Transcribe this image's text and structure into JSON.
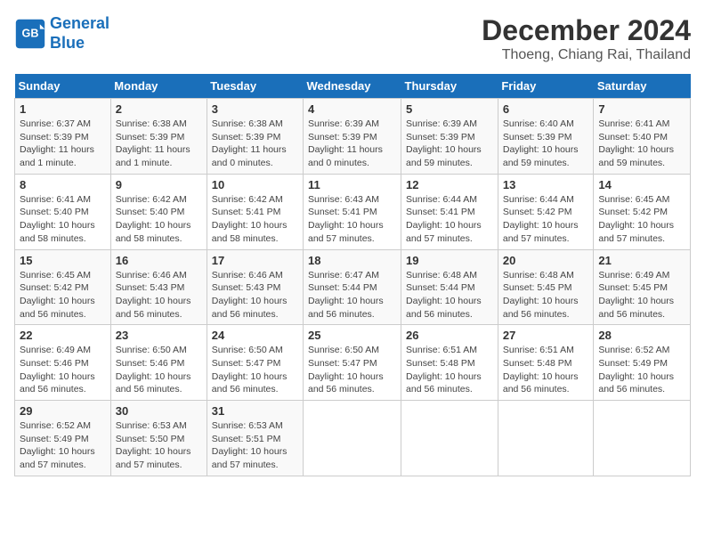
{
  "logo": {
    "line1": "General",
    "line2": "Blue"
  },
  "title": "December 2024",
  "location": "Thoeng, Chiang Rai, Thailand",
  "headers": [
    "Sunday",
    "Monday",
    "Tuesday",
    "Wednesday",
    "Thursday",
    "Friday",
    "Saturday"
  ],
  "weeks": [
    [
      {
        "day": "1",
        "info": "Sunrise: 6:37 AM\nSunset: 5:39 PM\nDaylight: 11 hours and 1 minute."
      },
      {
        "day": "2",
        "info": "Sunrise: 6:38 AM\nSunset: 5:39 PM\nDaylight: 11 hours and 1 minute."
      },
      {
        "day": "3",
        "info": "Sunrise: 6:38 AM\nSunset: 5:39 PM\nDaylight: 11 hours and 0 minutes."
      },
      {
        "day": "4",
        "info": "Sunrise: 6:39 AM\nSunset: 5:39 PM\nDaylight: 11 hours and 0 minutes."
      },
      {
        "day": "5",
        "info": "Sunrise: 6:39 AM\nSunset: 5:39 PM\nDaylight: 10 hours and 59 minutes."
      },
      {
        "day": "6",
        "info": "Sunrise: 6:40 AM\nSunset: 5:39 PM\nDaylight: 10 hours and 59 minutes."
      },
      {
        "day": "7",
        "info": "Sunrise: 6:41 AM\nSunset: 5:40 PM\nDaylight: 10 hours and 59 minutes."
      }
    ],
    [
      {
        "day": "8",
        "info": "Sunrise: 6:41 AM\nSunset: 5:40 PM\nDaylight: 10 hours and 58 minutes."
      },
      {
        "day": "9",
        "info": "Sunrise: 6:42 AM\nSunset: 5:40 PM\nDaylight: 10 hours and 58 minutes."
      },
      {
        "day": "10",
        "info": "Sunrise: 6:42 AM\nSunset: 5:41 PM\nDaylight: 10 hours and 58 minutes."
      },
      {
        "day": "11",
        "info": "Sunrise: 6:43 AM\nSunset: 5:41 PM\nDaylight: 10 hours and 57 minutes."
      },
      {
        "day": "12",
        "info": "Sunrise: 6:44 AM\nSunset: 5:41 PM\nDaylight: 10 hours and 57 minutes."
      },
      {
        "day": "13",
        "info": "Sunrise: 6:44 AM\nSunset: 5:42 PM\nDaylight: 10 hours and 57 minutes."
      },
      {
        "day": "14",
        "info": "Sunrise: 6:45 AM\nSunset: 5:42 PM\nDaylight: 10 hours and 57 minutes."
      }
    ],
    [
      {
        "day": "15",
        "info": "Sunrise: 6:45 AM\nSunset: 5:42 PM\nDaylight: 10 hours and 56 minutes."
      },
      {
        "day": "16",
        "info": "Sunrise: 6:46 AM\nSunset: 5:43 PM\nDaylight: 10 hours and 56 minutes."
      },
      {
        "day": "17",
        "info": "Sunrise: 6:46 AM\nSunset: 5:43 PM\nDaylight: 10 hours and 56 minutes."
      },
      {
        "day": "18",
        "info": "Sunrise: 6:47 AM\nSunset: 5:44 PM\nDaylight: 10 hours and 56 minutes."
      },
      {
        "day": "19",
        "info": "Sunrise: 6:48 AM\nSunset: 5:44 PM\nDaylight: 10 hours and 56 minutes."
      },
      {
        "day": "20",
        "info": "Sunrise: 6:48 AM\nSunset: 5:45 PM\nDaylight: 10 hours and 56 minutes."
      },
      {
        "day": "21",
        "info": "Sunrise: 6:49 AM\nSunset: 5:45 PM\nDaylight: 10 hours and 56 minutes."
      }
    ],
    [
      {
        "day": "22",
        "info": "Sunrise: 6:49 AM\nSunset: 5:46 PM\nDaylight: 10 hours and 56 minutes."
      },
      {
        "day": "23",
        "info": "Sunrise: 6:50 AM\nSunset: 5:46 PM\nDaylight: 10 hours and 56 minutes."
      },
      {
        "day": "24",
        "info": "Sunrise: 6:50 AM\nSunset: 5:47 PM\nDaylight: 10 hours and 56 minutes."
      },
      {
        "day": "25",
        "info": "Sunrise: 6:50 AM\nSunset: 5:47 PM\nDaylight: 10 hours and 56 minutes."
      },
      {
        "day": "26",
        "info": "Sunrise: 6:51 AM\nSunset: 5:48 PM\nDaylight: 10 hours and 56 minutes."
      },
      {
        "day": "27",
        "info": "Sunrise: 6:51 AM\nSunset: 5:48 PM\nDaylight: 10 hours and 56 minutes."
      },
      {
        "day": "28",
        "info": "Sunrise: 6:52 AM\nSunset: 5:49 PM\nDaylight: 10 hours and 56 minutes."
      }
    ],
    [
      {
        "day": "29",
        "info": "Sunrise: 6:52 AM\nSunset: 5:49 PM\nDaylight: 10 hours and 57 minutes."
      },
      {
        "day": "30",
        "info": "Sunrise: 6:53 AM\nSunset: 5:50 PM\nDaylight: 10 hours and 57 minutes."
      },
      {
        "day": "31",
        "info": "Sunrise: 6:53 AM\nSunset: 5:51 PM\nDaylight: 10 hours and 57 minutes."
      },
      null,
      null,
      null,
      null
    ]
  ]
}
